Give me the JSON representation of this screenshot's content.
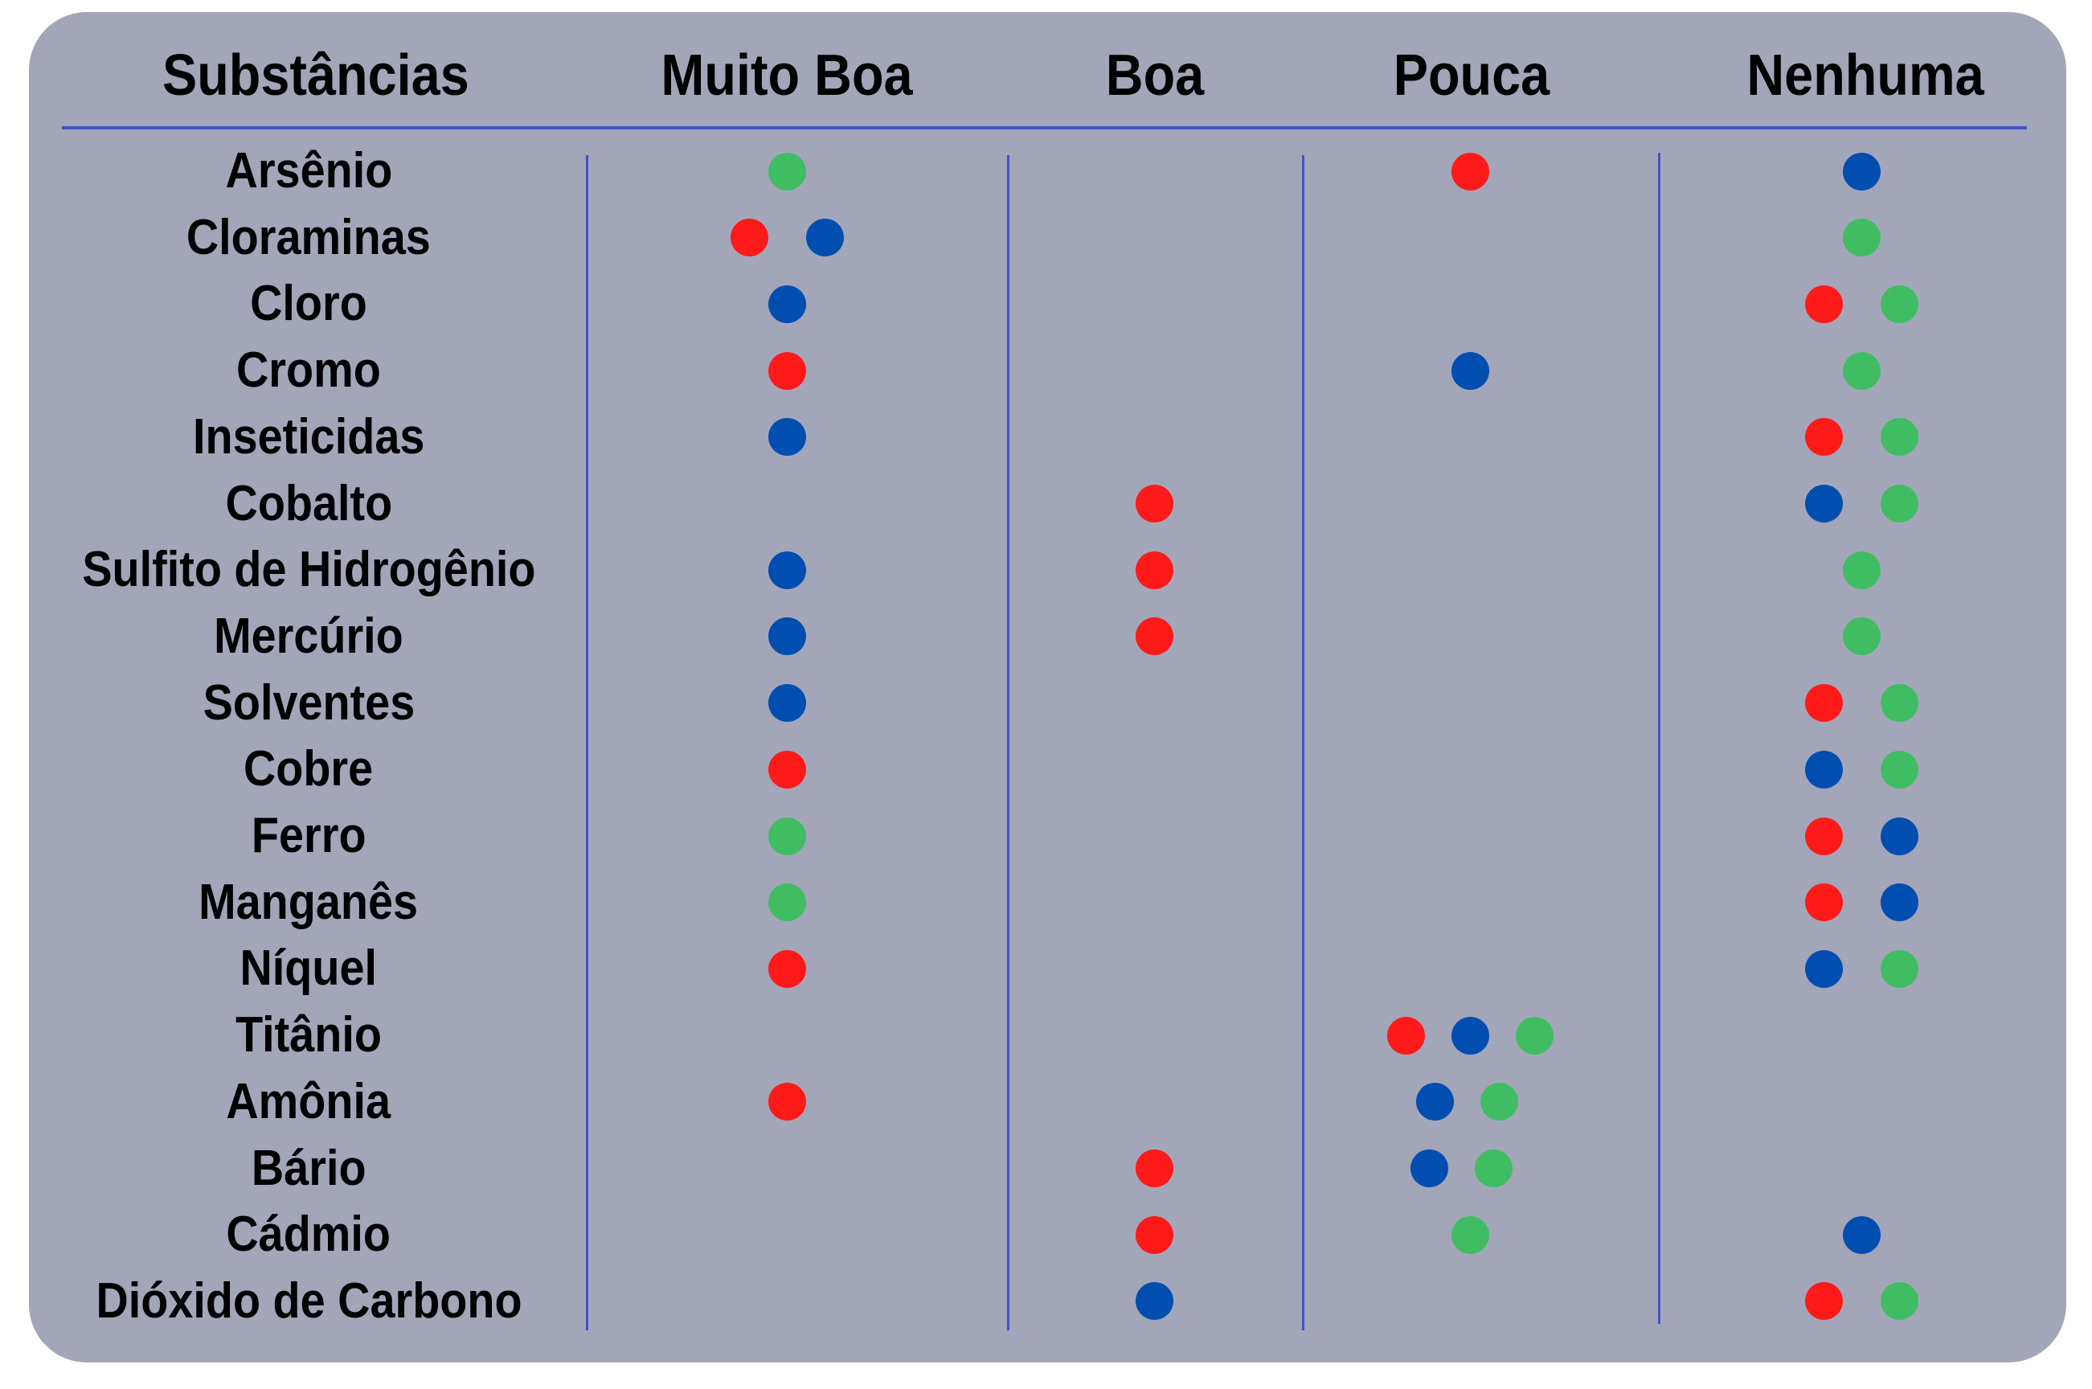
{
  "colors": {
    "background": "#a3a6b8",
    "lines": "#4453c6",
    "red": "#ff1a1a",
    "blue": "#004eaf",
    "green": "#40bd62"
  },
  "headers": {
    "substances": "Substâncias",
    "muito_boa": "Muito Boa",
    "boa": "Boa",
    "pouca": "Pouca",
    "nenhuma": "Nenhuma"
  },
  "columns": [
    "muito_boa",
    "boa",
    "pouca",
    "nenhuma"
  ],
  "rows": [
    {
      "name": "Arsênio",
      "muito_boa": [
        "green"
      ],
      "boa": [],
      "pouca": [
        "red"
      ],
      "nenhuma": [
        "blue"
      ]
    },
    {
      "name": "Cloraminas",
      "muito_boa": [
        "red",
        "blue"
      ],
      "boa": [],
      "pouca": [],
      "nenhuma": [
        "green"
      ]
    },
    {
      "name": "Cloro",
      "muito_boa": [
        "blue"
      ],
      "boa": [],
      "pouca": [],
      "nenhuma": [
        "red",
        "green"
      ]
    },
    {
      "name": "Cromo",
      "muito_boa": [
        "red"
      ],
      "boa": [],
      "pouca": [
        "blue"
      ],
      "nenhuma": [
        "green"
      ]
    },
    {
      "name": "Inseticidas",
      "muito_boa": [
        "blue"
      ],
      "boa": [],
      "pouca": [],
      "nenhuma": [
        "red",
        "green"
      ]
    },
    {
      "name": "Cobalto",
      "muito_boa": [],
      "boa": [
        "red"
      ],
      "pouca": [],
      "nenhuma": [
        "blue",
        "green"
      ]
    },
    {
      "name": "Sulfito de Hidrogênio",
      "muito_boa": [
        "blue"
      ],
      "boa": [
        "red"
      ],
      "pouca": [],
      "nenhuma": [
        "green"
      ]
    },
    {
      "name": "Mercúrio",
      "muito_boa": [
        "blue"
      ],
      "boa": [
        "red"
      ],
      "pouca": [],
      "nenhuma": [
        "green"
      ]
    },
    {
      "name": "Solventes",
      "muito_boa": [
        "blue"
      ],
      "boa": [],
      "pouca": [],
      "nenhuma": [
        "red",
        "green"
      ]
    },
    {
      "name": "Cobre",
      "muito_boa": [
        "red"
      ],
      "boa": [],
      "pouca": [],
      "nenhuma": [
        "blue",
        "green"
      ]
    },
    {
      "name": "Ferro",
      "muito_boa": [
        "green"
      ],
      "boa": [],
      "pouca": [],
      "nenhuma": [
        "red",
        "blue"
      ]
    },
    {
      "name": "Manganês",
      "muito_boa": [
        "green"
      ],
      "boa": [],
      "pouca": [],
      "nenhuma": [
        "red",
        "blue"
      ]
    },
    {
      "name": "Níquel",
      "muito_boa": [
        "red"
      ],
      "boa": [],
      "pouca": [],
      "nenhuma": [
        "blue",
        "green"
      ]
    },
    {
      "name": "Titânio",
      "muito_boa": [],
      "boa": [],
      "pouca": [
        "red",
        "blue",
        "green"
      ],
      "nenhuma": []
    },
    {
      "name": "Amônia",
      "muito_boa": [
        "red"
      ],
      "boa": [],
      "pouca": [
        "blue",
        "green"
      ],
      "nenhuma": []
    },
    {
      "name": "Bário",
      "muito_boa": [],
      "boa": [
        "red"
      ],
      "pouca": [
        "blue",
        "green"
      ],
      "nenhuma": []
    },
    {
      "name": "Cádmio",
      "muito_boa": [],
      "boa": [
        "red"
      ],
      "pouca": [
        "green"
      ],
      "nenhuma": [
        "blue"
      ]
    },
    {
      "name": "Dióxido de Carbono",
      "muito_boa": [],
      "boa": [
        "blue"
      ],
      "pouca": [],
      "nenhuma": [
        "red",
        "green"
      ]
    }
  ]
}
